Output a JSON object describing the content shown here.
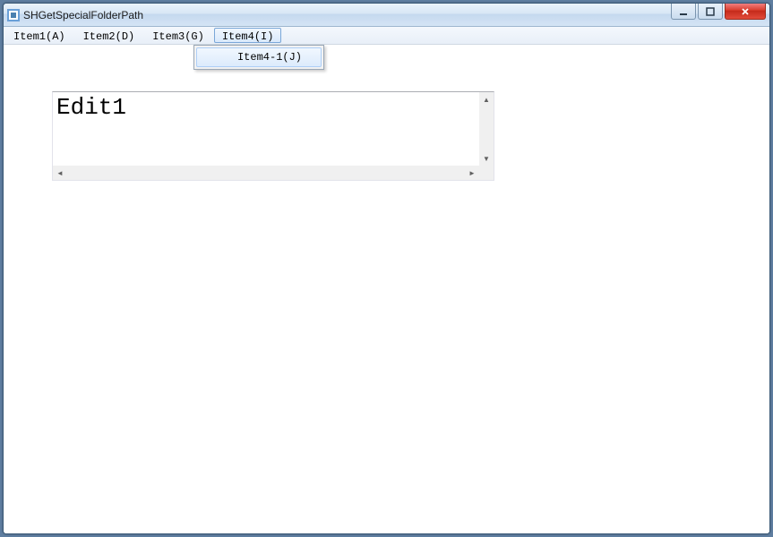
{
  "window": {
    "title": "SHGetSpecialFolderPath"
  },
  "menubar": {
    "items": [
      {
        "label": "Item1(A)"
      },
      {
        "label": "Item2(D)"
      },
      {
        "label": "Item3(G)"
      },
      {
        "label": "Item4(I)"
      }
    ],
    "active_index": 3
  },
  "dropdown": {
    "items": [
      {
        "label": "Item4-1(J)"
      }
    ]
  },
  "editor": {
    "content": "Edit1"
  },
  "icons": {
    "minimize": "minimize-icon",
    "maximize": "maximize-icon",
    "close": "close-icon",
    "scroll_up": "▲",
    "scroll_down": "▼",
    "scroll_left": "◄",
    "scroll_right": "►"
  }
}
